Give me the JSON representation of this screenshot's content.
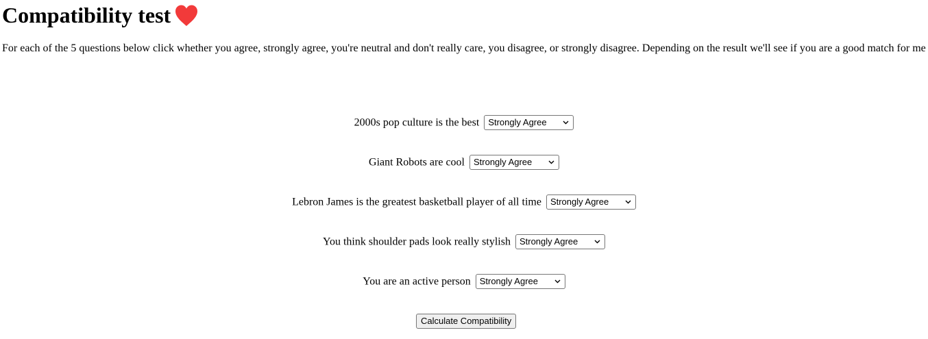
{
  "page": {
    "title": "Compatibility test",
    "intro": "For each of the 5 questions below click whether you agree, strongly agree, you're neutral and don't really care, you disagree, or strongly disagree. Depending on the result we'll see if you are a good match for me"
  },
  "questions": [
    {
      "label": "2000s pop culture is the best",
      "selected": "Strongly Agree"
    },
    {
      "label": "Giant Robots are cool",
      "selected": "Strongly Agree"
    },
    {
      "label": "Lebron James is the greatest basketball player of all time",
      "selected": "Strongly Agree"
    },
    {
      "label": "You think shoulder pads look really stylish",
      "selected": "Strongly Agree"
    },
    {
      "label": "You are an active person",
      "selected": "Strongly Agree"
    }
  ],
  "button": {
    "calculate_label": "Calculate Compatibility"
  },
  "icons": {
    "title_icon": "heart-icon",
    "select_icon": "chevron-down-icon"
  },
  "colors": {
    "heart": "#f23a3a"
  }
}
